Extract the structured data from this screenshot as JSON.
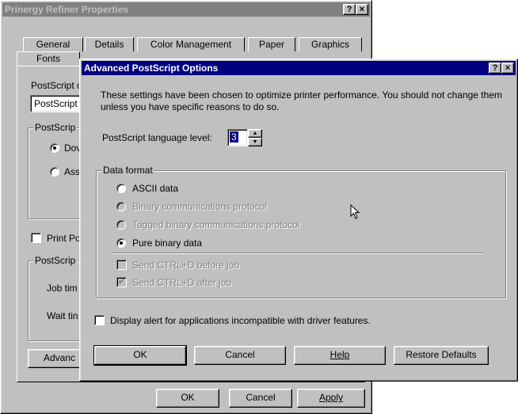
{
  "outer": {
    "title": "Prinergy Refiner Properties",
    "help_btn": "?",
    "close_btn": "×",
    "tabs_row1": [
      "General",
      "Details",
      "Color Management",
      "Paper",
      "Graphics"
    ],
    "tabs_row2": [
      "Fonts"
    ],
    "left_labels": {
      "ps_label": "PostScript o",
      "ps_field": "PostScript",
      "ps_group": "PostScrip",
      "radio1": "Dov",
      "radio2": "Ass",
      "print_po": "Print Po",
      "ps_group2": "PostScrip",
      "job_time": "Job tim",
      "wait_time": "Wait tin",
      "advanced": "Advanc"
    },
    "ok": "OK",
    "cancel": "Cancel",
    "apply": "Apply"
  },
  "dialog": {
    "title": "Advanced PostScript Options",
    "help_btn": "?",
    "close_btn": "×",
    "intro_line1": "These settings have been chosen to optimize printer performance. You should not change them",
    "intro_line2": "unless you have specific reasons to do so.",
    "lang_level_label": "PostScript language level:",
    "lang_level_value": "3",
    "data_format_label": "Data format",
    "options": {
      "ascii": "ASCII data",
      "binary_comm": "Binary communications protocol",
      "tagged": "Tagged binary communications protocol",
      "pure_binary": "Pure binary data",
      "ctrl_d_before": "Send CTRL+D before job",
      "ctrl_d_after": "Send CTRL+D after job"
    },
    "display_alert": "Display alert for applications incompatible with driver features.",
    "ok": "OK",
    "cancel": "Cancel",
    "help": "Help",
    "restore": "Restore Defaults"
  },
  "colors": {
    "face": "#c0c0c0",
    "active_title": "#000080",
    "inactive_title": "#808080"
  }
}
